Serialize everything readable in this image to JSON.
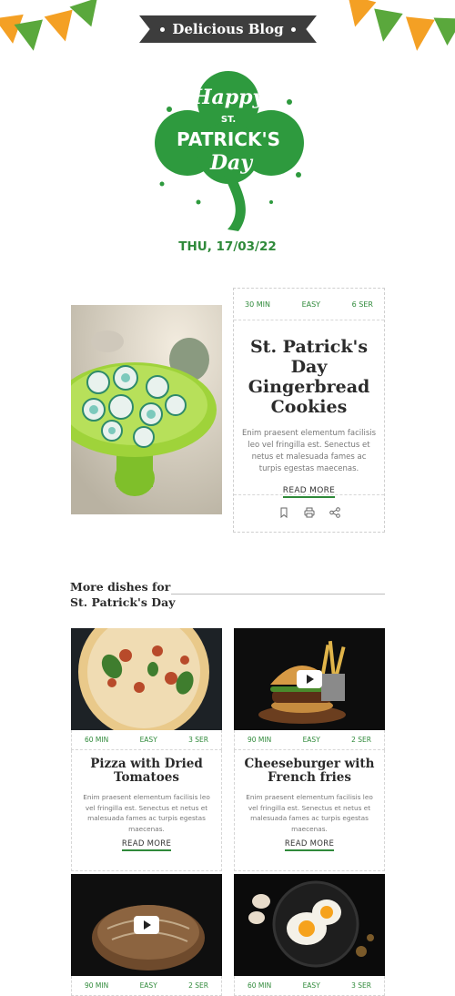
{
  "header": {
    "blog_name": "Delicious Blog"
  },
  "hero": {
    "logo_text_1": "Happy",
    "logo_text_2": "ST.",
    "logo_text_3": "PATRICK'S",
    "logo_text_4": "Day",
    "date": "THU, 17/03/22"
  },
  "feature": {
    "time": "30 MIN",
    "difficulty": "EASY",
    "servings": "6 SER",
    "title": "St. Patrick's Day Gingerbread Cookies",
    "description": "Enim praesent elementum facilisis leo vel fringilla est. Senectus et netus et malesuada fames ac turpis egestas maecenas.",
    "read_more": "READ MORE"
  },
  "more": {
    "title_line1": "More dishes for",
    "title_line2": "St. Patrick's Day",
    "cards": [
      {
        "time": "60 MIN",
        "difficulty": "EASY",
        "servings": "3 SER",
        "title": "Pizza with Dried Tomatoes",
        "description": "Enim praesent elementum facilisis leo vel fringilla est. Senectus et netus et malesuada fames ac turpis egestas maecenas.",
        "read_more": "READ MORE"
      },
      {
        "time": "90 MIN",
        "difficulty": "EASY",
        "servings": "2 SER",
        "title": "Cheeseburger with French fries",
        "description": "Enim praesent elementum facilisis leo vel fringilla est. Senectus et netus et malesuada fames ac turpis egestas maecenas.",
        "read_more": "READ MORE"
      },
      {
        "time": "90 MIN",
        "difficulty": "EASY",
        "servings": "2 SER"
      },
      {
        "time": "60 MIN",
        "difficulty": "EASY",
        "servings": "3 SER"
      }
    ]
  },
  "colors": {
    "accent_green": "#2f8a3a",
    "bunting_orange": "#f4a024",
    "bunting_green": "#5aa83c",
    "banner_dark": "#3d3d3d"
  }
}
